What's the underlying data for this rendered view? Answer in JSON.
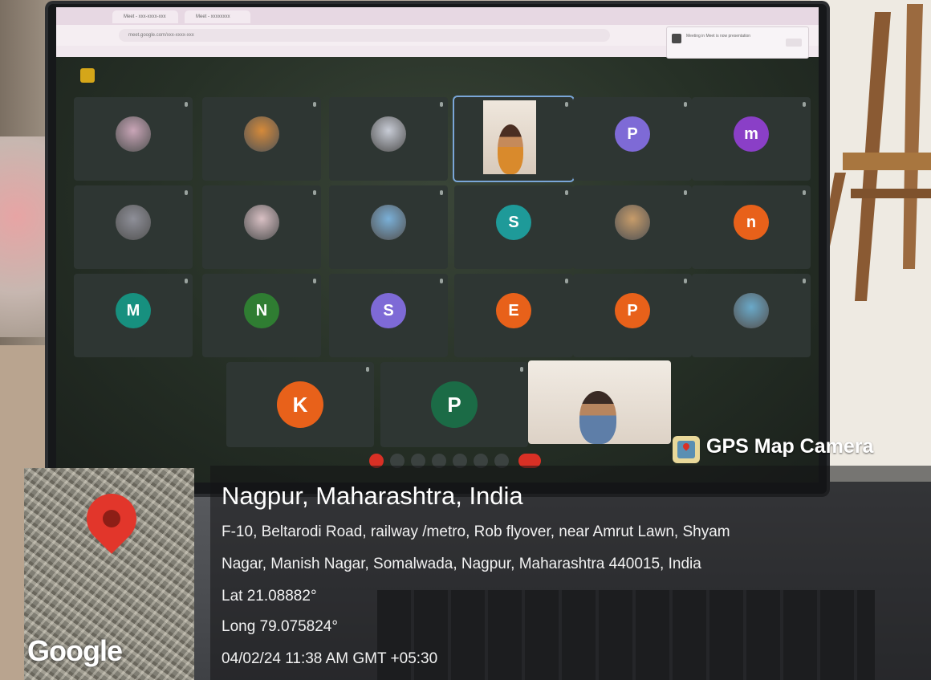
{
  "browser": {
    "tabs": [
      "Meet - xxx-xxxx-xxx",
      "Meet - xxxxxxxx"
    ],
    "address": "meet.google.com/xxx-xxxx-xxx",
    "notification": "Meeting in Meet is now presentation"
  },
  "meeting": {
    "grid": [
      {
        "initial": "",
        "color": "#c9a5b7",
        "kind": "photo"
      },
      {
        "initial": "",
        "color": "#d58a3a",
        "kind": "photo"
      },
      {
        "initial": "",
        "color": "#c8ccd6",
        "kind": "photo"
      },
      {
        "initial": "",
        "color": "#e9dccd",
        "kind": "video",
        "pinned": true
      },
      {
        "initial": "P",
        "color": "#7e6ad6",
        "kind": "letter"
      },
      {
        "initial": "m",
        "color": "#8a3fc7",
        "kind": "letter"
      },
      {
        "initial": "",
        "color": "#8e8f98",
        "kind": "photo"
      },
      {
        "initial": "",
        "color": "#d9c0c4",
        "kind": "photo"
      },
      {
        "initial": "",
        "color": "#7ab0d8",
        "kind": "photo"
      },
      {
        "initial": "S",
        "color": "#1e9a99",
        "kind": "letter"
      },
      {
        "initial": "",
        "color": "#c79c6a",
        "kind": "photo"
      },
      {
        "initial": "n",
        "color": "#e8611a",
        "kind": "letter"
      },
      {
        "initial": "M",
        "color": "#17907f",
        "kind": "letter"
      },
      {
        "initial": "N",
        "color": "#2f7d32",
        "kind": "letter"
      },
      {
        "initial": "S",
        "color": "#7e6ad6",
        "kind": "letter"
      },
      {
        "initial": "E",
        "color": "#e8611a",
        "kind": "letter"
      },
      {
        "initial": "P",
        "color": "#e8611a",
        "kind": "letter"
      },
      {
        "initial": "",
        "color": "#6aa9c9",
        "kind": "photo"
      }
    ],
    "bottom": [
      {
        "initial": "K",
        "color": "#e8611a"
      },
      {
        "initial": "P",
        "color": "#1b6b46"
      }
    ]
  },
  "gps": {
    "brand": "GPS Map Camera",
    "city": "Nagpur, Maharashtra, India",
    "address_line1": "F-10, Beltarodi Road, railway /metro, Rob flyover, near Amrut Lawn, Shyam",
    "address_line2": "Nagar, Manish Nagar, Somalwada, Nagpur, Maharashtra 440015, India",
    "lat": "Lat 21.08882°",
    "long": "Long 79.075824°",
    "datetime": "04/02/24 11:38 AM GMT +05:30",
    "map_logo": "Google",
    "pin_color": "#e2362b"
  }
}
